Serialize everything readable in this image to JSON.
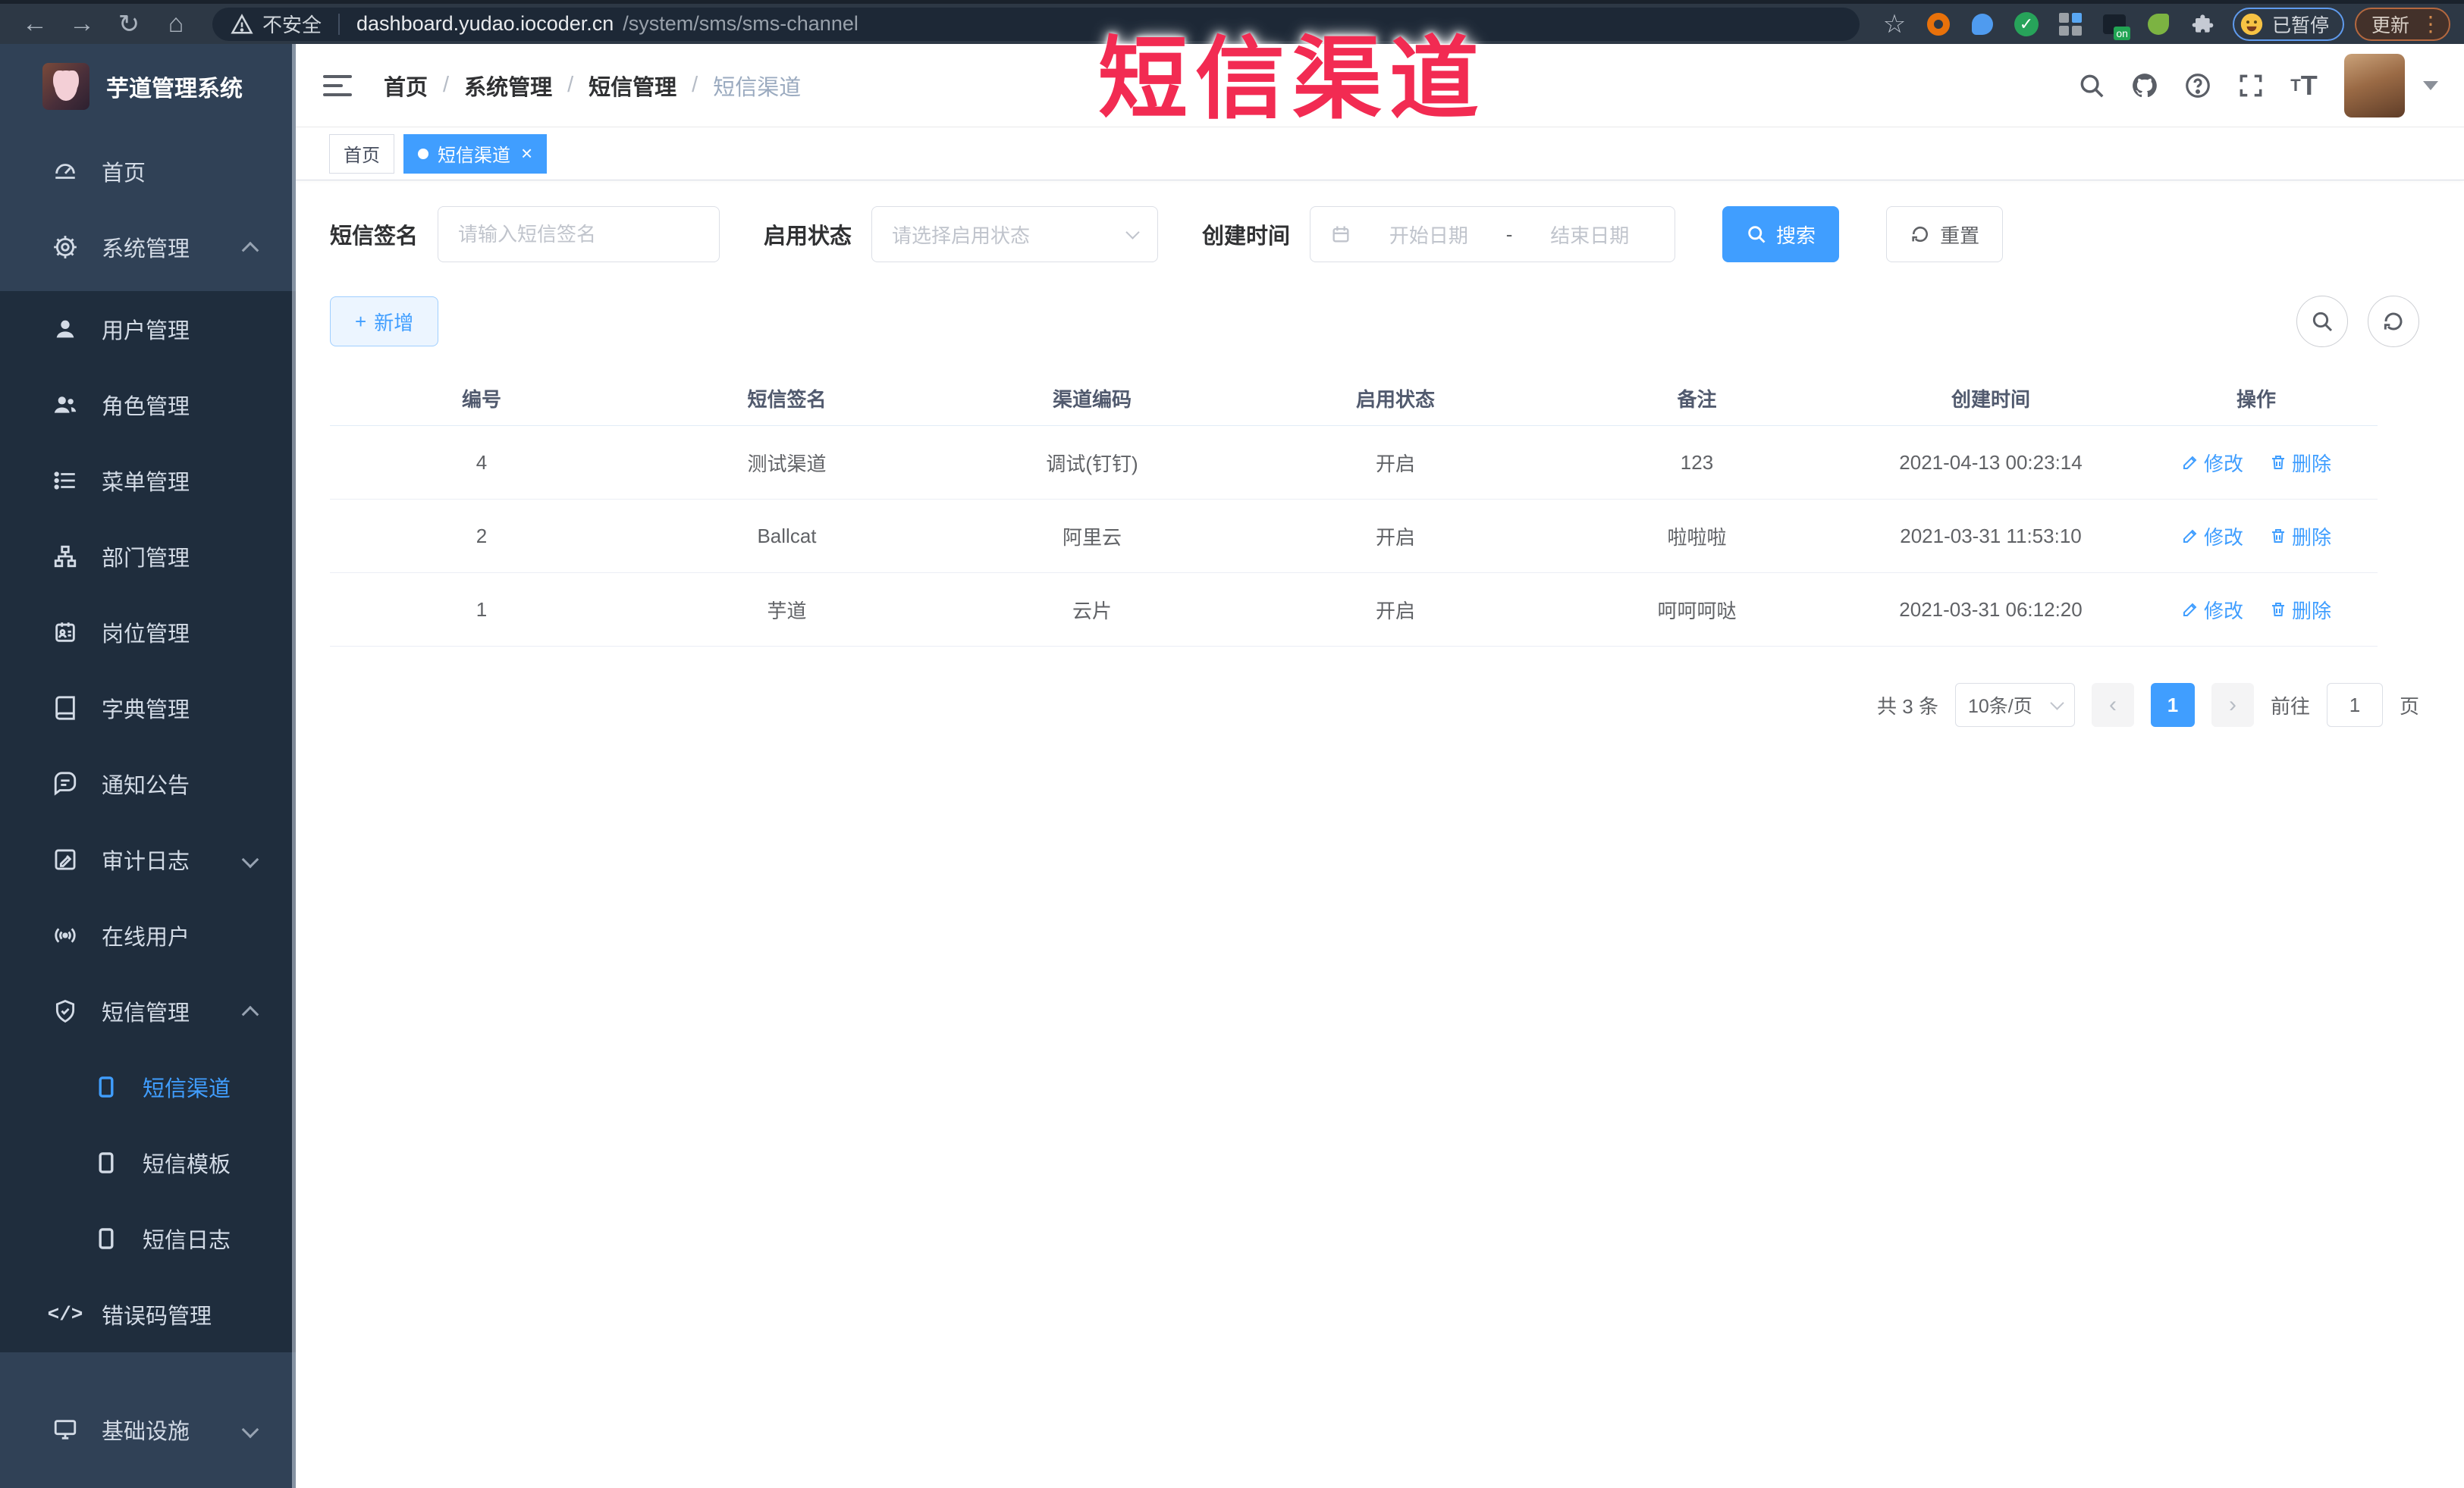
{
  "colors": {
    "accent": "#409eff",
    "annotation_red": "#f22b52",
    "sidebar_bg": "#304156",
    "submenu_bg": "#1f2d3d",
    "browser_bar": "#2d3845"
  },
  "annotation": {
    "text": "短信渠道"
  },
  "browser": {
    "security_label": "不安全",
    "url_domain": "dashboard.yudao.iocoder.cn",
    "url_path": "/system/sms/sms-channel",
    "paused_label": "已暂停",
    "update_label": "更新"
  },
  "sidebar": {
    "title": "芋道管理系统",
    "items": [
      {
        "label": "首页"
      },
      {
        "label": "系统管理"
      },
      {
        "label": "用户管理"
      },
      {
        "label": "角色管理"
      },
      {
        "label": "菜单管理"
      },
      {
        "label": "部门管理"
      },
      {
        "label": "岗位管理"
      },
      {
        "label": "字典管理"
      },
      {
        "label": "通知公告"
      },
      {
        "label": "审计日志"
      },
      {
        "label": "在线用户"
      },
      {
        "label": "短信管理"
      },
      {
        "label": "短信渠道"
      },
      {
        "label": "短信模板"
      },
      {
        "label": "短信日志"
      },
      {
        "label": "错误码管理"
      },
      {
        "label": "基础设施"
      }
    ]
  },
  "header": {
    "breadcrumb": [
      "首页",
      "系统管理",
      "短信管理",
      "短信渠道"
    ],
    "separator": "/"
  },
  "tabs": {
    "home": "首页",
    "active": "短信渠道",
    "close": "×"
  },
  "filters": {
    "sign_label": "短信签名",
    "sign_placeholder": "请输入短信签名",
    "status_label": "启用状态",
    "status_placeholder": "请选择启用状态",
    "time_label": "创建时间",
    "date_start": "开始日期",
    "date_sep": "-",
    "date_end": "结束日期",
    "search": "搜索",
    "reset": "重置"
  },
  "toolbar": {
    "add": "新增"
  },
  "table": {
    "columns": [
      "编号",
      "短信签名",
      "渠道编码",
      "启用状态",
      "备注",
      "创建时间",
      "操作"
    ],
    "edit": "修改",
    "delete": "删除",
    "rows": [
      {
        "id": "4",
        "sign": "测试渠道",
        "code": "调试(钉钉)",
        "status": "开启",
        "remark": "123",
        "created": "2021-04-13 00:23:14"
      },
      {
        "id": "2",
        "sign": "Ballcat",
        "code": "阿里云",
        "status": "开启",
        "remark": "啦啦啦",
        "created": "2021-03-31 11:53:10"
      },
      {
        "id": "1",
        "sign": "芋道",
        "code": "云片",
        "status": "开启",
        "remark": "呵呵呵哒",
        "created": "2021-03-31 06:12:20"
      }
    ]
  },
  "pagination": {
    "total": "共 3 条",
    "page_size": "10条/页",
    "page": "1",
    "goto": "前往",
    "goto_value": "1",
    "unit": "页"
  }
}
